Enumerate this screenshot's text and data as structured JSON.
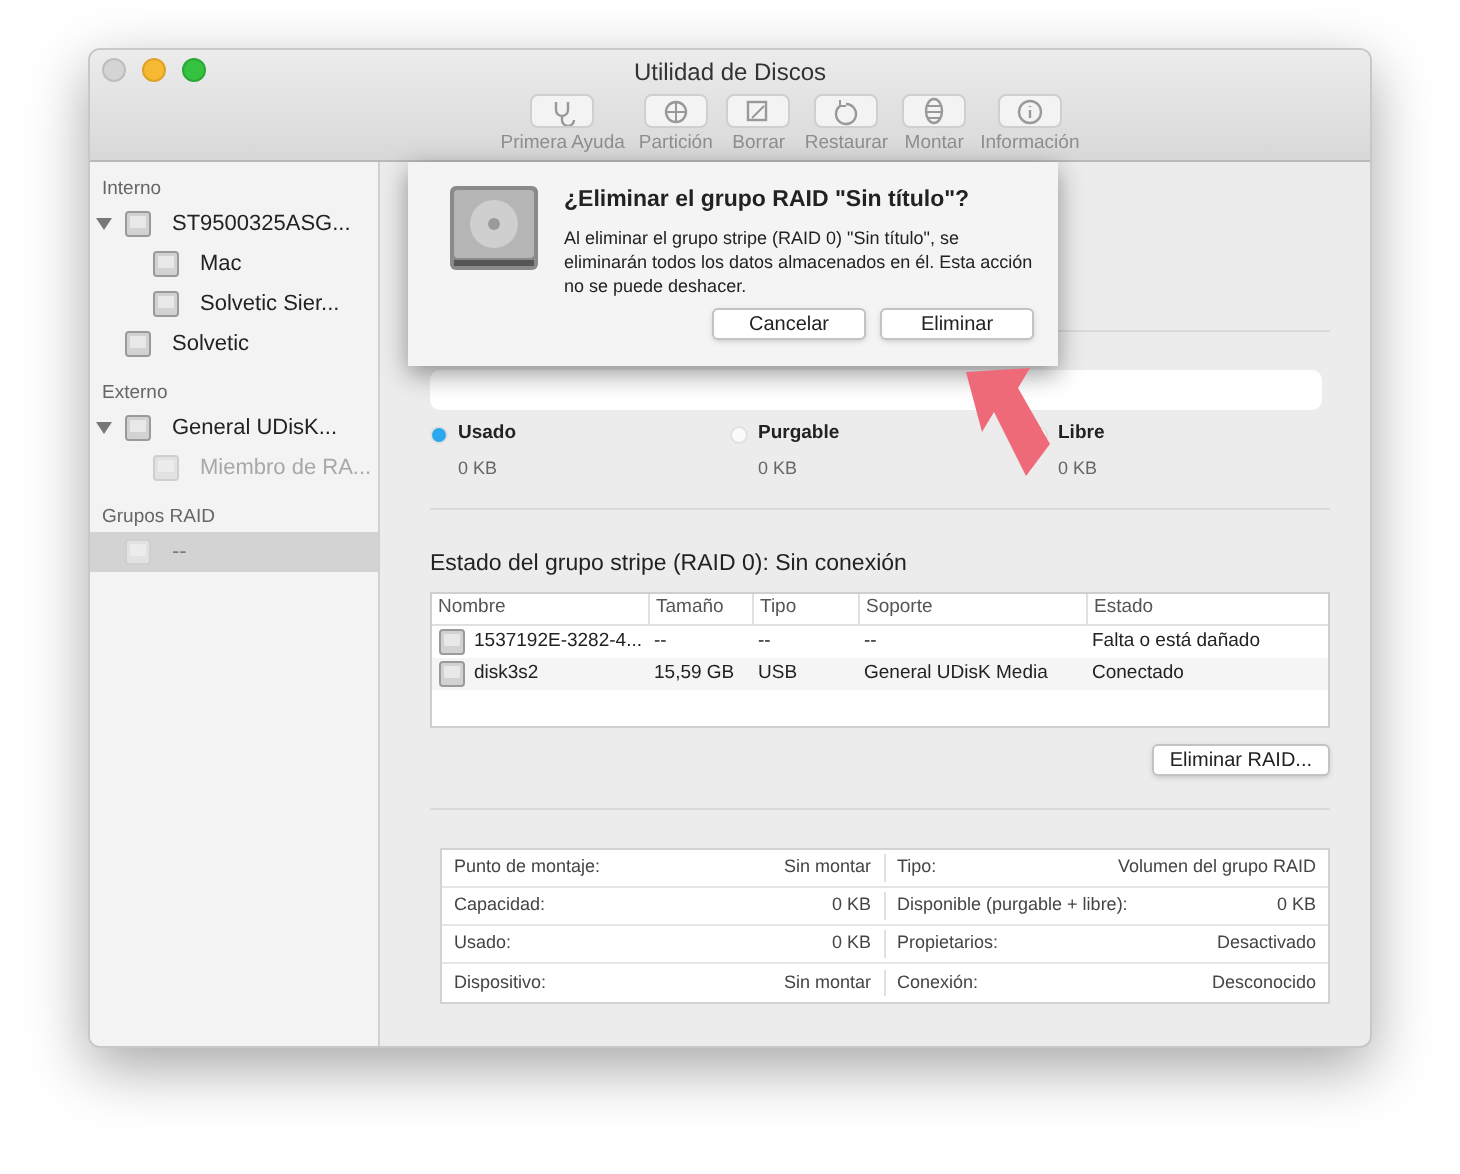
{
  "window": {
    "title": "Utilidad de Discos"
  },
  "toolbar": [
    {
      "label": "Primera Ayuda",
      "disabled": true,
      "kind": "stethoscope"
    },
    {
      "label": "Partición",
      "disabled": true,
      "kind": "pie"
    },
    {
      "label": "Borrar",
      "disabled": true,
      "kind": "erase"
    },
    {
      "label": "Restaurar",
      "disabled": true,
      "kind": "restore"
    },
    {
      "label": "Montar",
      "disabled": true,
      "kind": "mount"
    },
    {
      "label": "Información",
      "disabled": true,
      "kind": "info"
    }
  ],
  "sidebar": {
    "sections": [
      {
        "title": "Interno",
        "items": [
          {
            "label": "ST9500325ASG...",
            "expanded": true,
            "selected": false,
            "disabled": false,
            "children": [
              {
                "label": "Mac",
                "selected": false,
                "disabled": false
              },
              {
                "label": "Solvetic Sier...",
                "selected": false,
                "disabled": false
              }
            ]
          },
          {
            "label": "Solvetic",
            "selected": false,
            "disabled": false
          }
        ]
      },
      {
        "title": "Externo",
        "items": [
          {
            "label": "General UDisK...",
            "expanded": true,
            "selected": false,
            "disabled": false,
            "children": [
              {
                "label": "Miembro de RA...",
                "selected": false,
                "disabled": true
              }
            ]
          }
        ]
      },
      {
        "title": "Grupos RAID",
        "items": [
          {
            "label": "--",
            "selected": true,
            "disabled": true
          }
        ]
      }
    ]
  },
  "dialog": {
    "title": "¿Eliminar el grupo RAID \"Sin título\"?",
    "message": "Al eliminar el grupo stripe (RAID 0) \"Sin título\", se eliminarán todos los datos almacenados en él. Esta acción no se puede deshacer.",
    "buttons": [
      "Cancelar",
      "Eliminar"
    ]
  },
  "usage": {
    "legend": [
      {
        "label": "Usado",
        "value": "0 KB",
        "color": "#2aa9f1"
      },
      {
        "label": "Purgable",
        "value": "0 KB",
        "color": "#fafafa"
      },
      {
        "label": "Libre",
        "value": "0 KB",
        "color": "#fafafa"
      }
    ]
  },
  "raid": {
    "heading": "Estado del grupo stripe (RAID 0): Sin conexión",
    "columns": [
      "Nombre",
      "Tamaño",
      "Tipo",
      "Soporte",
      "Estado"
    ],
    "rows": [
      [
        "1537192E-3282-4...",
        "--",
        "--",
        "--",
        "Falta o está dañado"
      ],
      [
        "disk3s2",
        "15,59 GB",
        "USB",
        "General UDisK Media",
        "Conectado"
      ]
    ],
    "button": "Eliminar RAID..."
  },
  "info": [
    [
      "Punto de montaje:",
      "Sin montar",
      "Tipo:",
      "Volumen del grupo RAID"
    ],
    [
      "Capacidad:",
      "0 KB",
      "Disponible (purgable + libre):",
      "0 KB"
    ],
    [
      "Usado:",
      "0 KB",
      "Propietarios:",
      "Desactivado"
    ],
    [
      "Dispositivo:",
      "Sin montar",
      "Conexión:",
      "Desconocido"
    ]
  ]
}
